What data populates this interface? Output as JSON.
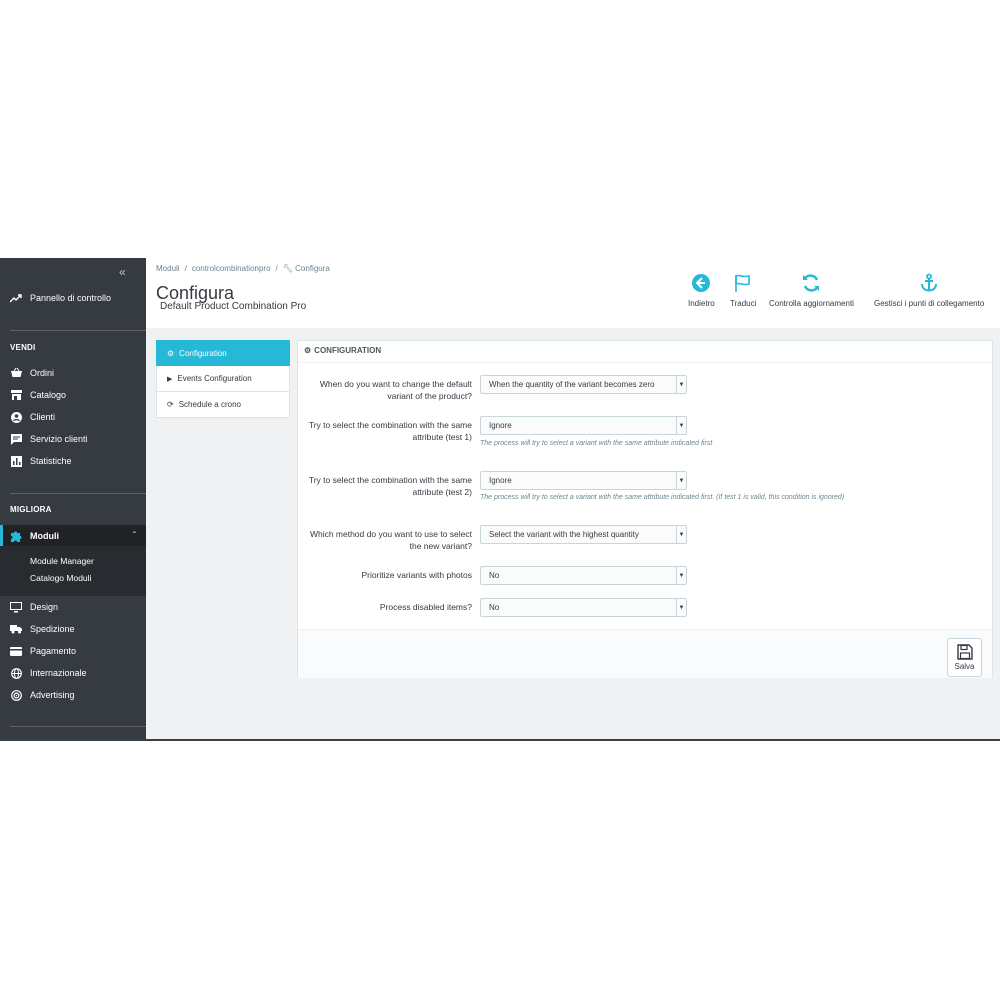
{
  "sidebar": {
    "collapse": "«",
    "dashboard": "Pannello di controllo",
    "sections": [
      {
        "title": "VENDI",
        "items": [
          "Ordini",
          "Catalogo",
          "Clienti",
          "Servizio clienti",
          "Statistiche"
        ]
      },
      {
        "title": "MIGLIORA",
        "active": "Moduli",
        "subitems": [
          "Module Manager",
          "Catalogo Moduli"
        ],
        "items": [
          "Design",
          "Spedizione",
          "Pagamento",
          "Internazionale",
          "Advertising"
        ]
      }
    ]
  },
  "header": {
    "breadcrumb": [
      "Moduli",
      "/",
      "controlcombinationpro",
      "/",
      "Configura"
    ],
    "title": "Configura",
    "subtitle": "Default Product Combination Pro",
    "toolbar": [
      "Indietro",
      "Traduci",
      "Controlla aggiornamenti",
      "Gestisci i punti di collegamento"
    ]
  },
  "tabs": [
    {
      "label": "Configuration",
      "active": true
    },
    {
      "label": "Events Configuration"
    },
    {
      "label": "Schedule a crono"
    }
  ],
  "panel": {
    "title": "CONFIGURATION",
    "rows": [
      {
        "label": "When do you want to change the default variant of the product?",
        "value": "When the quantity of the variant becomes zero",
        "help": ""
      },
      {
        "label": "Try to select the combination with the same attribute (test 1)",
        "value": "Ignore",
        "help": "The process will try to select a variant with the same attribute indicated first"
      },
      {
        "label": "Try to select the combination with the same attribute (test 2)",
        "value": "Ignore",
        "help": "The process will try to select a variant with the same attribute indicated first. (If test 1 is valid, this condition is ignored)"
      },
      {
        "label": "Which method do you want to use to select the new variant?",
        "value": "Select the variant with the highest quantity",
        "help": ""
      },
      {
        "label": "Prioritize variants with photos",
        "value": "No",
        "help": ""
      },
      {
        "label": "Process disabled items?",
        "value": "No",
        "help": ""
      }
    ],
    "save": "Salva"
  },
  "colors": {
    "accent": "#25b9d7",
    "sidebar": "#363a41"
  }
}
